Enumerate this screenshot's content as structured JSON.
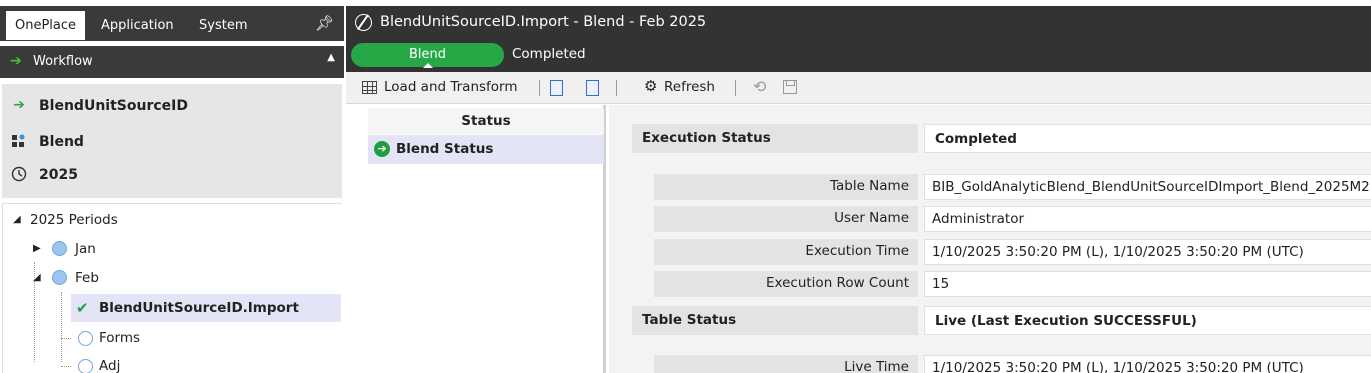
{
  "left_panel": {
    "tabs": [
      {
        "label": "OnePlace"
      },
      {
        "label": "Application"
      },
      {
        "label": "System"
      }
    ],
    "pin_icon": "pin-icon",
    "workflow_header": {
      "label": "Workflow"
    },
    "pov": {
      "workflow": "BlendUnitSourceID",
      "scenario": "Blend",
      "time": "2025"
    },
    "tree": {
      "root": "2025 Periods",
      "jan": "Jan",
      "feb": "Feb",
      "selected_step": "BlendUnitSourceID.Import",
      "forms": "Forms",
      "adj": "Adj"
    }
  },
  "title_bar": {
    "title": "BlendUnitSourceID.Import  -  Blend  -  Feb 2025",
    "step_pill": "Blend",
    "step_status": "Completed"
  },
  "toolbar": {
    "load_transform": "Load and Transform",
    "refresh": "Refresh"
  },
  "status_pane": {
    "header": "Status",
    "item": "Blend Status"
  },
  "detail": {
    "execution_status_label": "Execution Status",
    "execution_status_value": "Completed",
    "fields": [
      {
        "label": "Table Name",
        "value": "BIB_GoldAnalyticBlend_BlendUnitSourceIDImport_Blend_2025M2"
      },
      {
        "label": "User Name",
        "value": "Administrator"
      },
      {
        "label": "Execution Time",
        "value": "1/10/2025 3:50:20 PM (L), 1/10/2025 3:50:20 PM (UTC)"
      },
      {
        "label": "Execution Row Count",
        "value": "15"
      }
    ],
    "table_status_label": "Table Status",
    "table_status_value": "Live (Last Execution SUCCESSFUL)",
    "live_time_label": "Live Time",
    "live_time_value": "1/10/2025 3:50:20 PM (L), 1/10/2025 3:50:20 PM (UTC)"
  },
  "colors": {
    "accent_green": "#27a847",
    "dark_bar": "#333333",
    "selection": "#e4e4f7"
  }
}
